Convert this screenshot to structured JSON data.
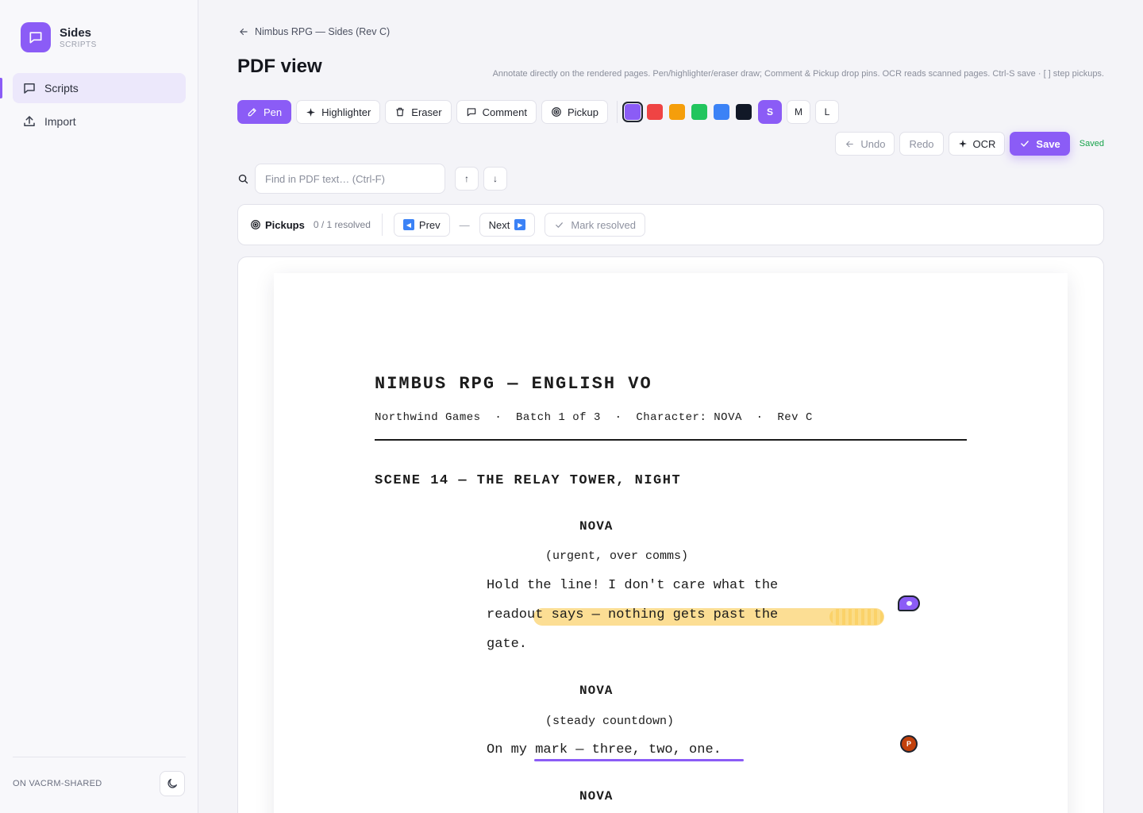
{
  "app": {
    "name": "Sides",
    "subtitle": "SCRIPTS"
  },
  "sidebar": {
    "items": [
      {
        "label": "Scripts",
        "icon": "message-square-icon",
        "active": true
      },
      {
        "label": "Import",
        "icon": "upload-icon",
        "active": false
      }
    ],
    "footer_label": "ON VACRM-SHARED",
    "theme_icon": "moon-icon"
  },
  "header": {
    "breadcrumb": "Nimbus RPG — Sides (Rev C)",
    "title": "PDF view",
    "hint": "Annotate directly on the rendered pages. Pen/highlighter/eraser draw; Comment & Pickup drop pins. OCR reads scanned pages. Ctrl-S save · [ ] step pickups."
  },
  "toolbar": {
    "tools": [
      {
        "label": "Pen",
        "icon": "pen-icon",
        "active": true
      },
      {
        "label": "Highlighter",
        "icon": "sparkle-icon",
        "active": false
      },
      {
        "label": "Eraser",
        "icon": "trash-icon",
        "active": false
      },
      {
        "label": "Comment",
        "icon": "comment-icon",
        "active": false
      },
      {
        "label": "Pickup",
        "icon": "target-icon",
        "active": false
      }
    ],
    "colors": [
      "#8b5cf6",
      "#ef4444",
      "#f59e0b",
      "#22c55e",
      "#3b82f6",
      "#111827"
    ],
    "selected_color": "#8b5cf6",
    "sizes": [
      "S",
      "M",
      "L"
    ],
    "selected_size": "S"
  },
  "actions": {
    "undo": "Undo",
    "redo": "Redo",
    "ocr": "OCR",
    "save": "Save",
    "status": "Saved"
  },
  "search": {
    "placeholder": "Find in PDF text… (Ctrl-F)",
    "value": "",
    "up": "↑",
    "down": "↓"
  },
  "pickups": {
    "title": "Pickups",
    "count": "0 / 1 resolved",
    "prev": "Prev",
    "separator": "—",
    "next": "Next",
    "mark_resolved": "Mark resolved"
  },
  "document": {
    "title": "NIMBUS RPG — ENGLISH VO",
    "meta": "Northwind Games  ·  Batch 1 of 3  ·  Character: NOVA  ·  Rev C",
    "scene": "SCENE 14 — THE RELAY TOWER, NIGHT",
    "blocks": [
      {
        "character": "NOVA",
        "paren": "(urgent, over comms)",
        "lines": [
          "Hold the line! I don't care what the",
          "readout says — nothing gets past the",
          "gate."
        ]
      },
      {
        "character": "NOVA",
        "paren": "(steady countdown)",
        "lines": [
          "On my mark — three, two, one."
        ]
      },
      {
        "character": "NOVA"
      }
    ],
    "pickup_pin_label": "P"
  }
}
